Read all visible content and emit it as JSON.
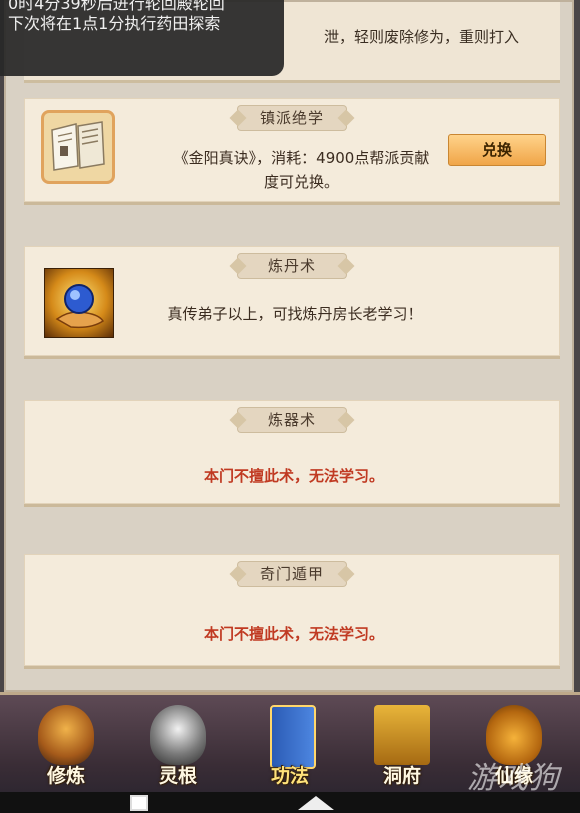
{
  "notification": {
    "line1": "0时4分39秒后进行轮回殿轮回",
    "line2": "下次将在1点1分执行药田探索"
  },
  "top_card": {
    "text": "泄，轻则废除修为，重则打入"
  },
  "cards": [
    {
      "title": "镇派绝学",
      "desc": "《金阳真诀》，消耗：4900点帮派贡献度可兑换。",
      "button": "兑换",
      "icon": "book-icon"
    },
    {
      "title": "炼丹术",
      "desc": "真传弟子以上，可找炼丹房长老学习！",
      "icon": "orb-icon"
    },
    {
      "title": "炼器术",
      "desc": "本门不擅此术，无法学习。"
    },
    {
      "title": "奇门遁甲",
      "desc": "本门不擅此术，无法学习。"
    }
  ],
  "tabs": [
    {
      "label": "修炼",
      "icon": "cultivate-icon"
    },
    {
      "label": "灵根",
      "icon": "spirit-root-icon"
    },
    {
      "label": "功法",
      "icon": "technique-book-icon",
      "active": true
    },
    {
      "label": "洞府",
      "icon": "cave-dwelling-icon"
    },
    {
      "label": "仙缘",
      "icon": "gourd-icon"
    }
  ],
  "watermark": "游戏狗",
  "colors": {
    "accent": "#f0a548",
    "red_text": "#c03a22",
    "panel": "#d9d1c4",
    "card": "#f4ebdb"
  }
}
